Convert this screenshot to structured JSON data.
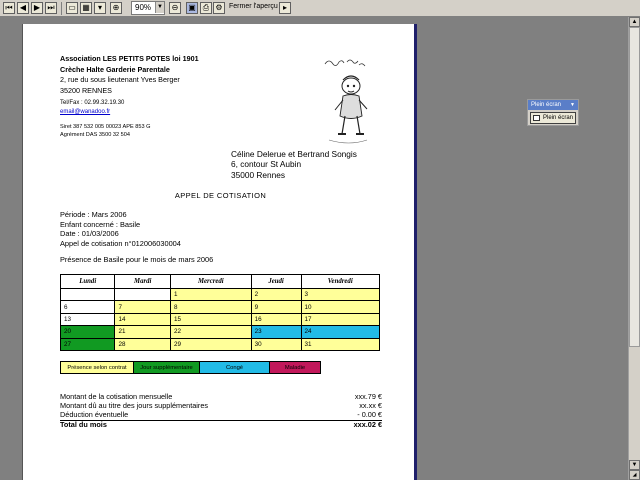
{
  "toolbar": {
    "zoom_value": "90%",
    "close_preview_label": "Fermer l'aperçu"
  },
  "icons": [
    "first-page-icon",
    "prev-page-icon",
    "next-page-icon",
    "last-page-icon",
    "one-page-icon",
    "multi-page-icon",
    "zoom-in-icon",
    "zoom-out-icon",
    "single-view-icon",
    "print-icon",
    "print-setup-icon",
    "export-icon"
  ],
  "org": {
    "line1": "Association LES PETITS POTES loi 1901",
    "line2": "Crèche Halte Garderie Parentale",
    "line3": "2, rue du sous lieutenant Yves Berger",
    "line4": "35200 RENNES"
  },
  "contact": {
    "telfax": "Tel/Fax : 02.99.32.19.30",
    "email": "email@wanadoo.fr"
  },
  "siret": {
    "line1": "Siret 387 532 005 00023 APE 853 G",
    "line2": "Agrément DAS 3500 32 504"
  },
  "recipient": {
    "name": "Céline Delerue et Bertrand Songis",
    "street": "6, contour St Aubin",
    "city": "35000 Rennes"
  },
  "title": "APPEL DE COTISATION",
  "info": {
    "period": "Période : Mars 2006",
    "child": "Enfant concerné : Basile",
    "date": "Date : 01/03/2006",
    "call": "Appel de cotisation n°012006030004"
  },
  "presence_text": "Présence de Basile pour le mois de mars 2006",
  "calendar": {
    "headers": [
      "Lundi",
      "Mardi",
      "Mercredi",
      "Jeudi",
      "Vendredi"
    ],
    "rows": [
      [
        {
          "t": "",
          "c": "#ffffff"
        },
        {
          "t": "",
          "c": "#ffffff"
        },
        {
          "t": "1",
          "c": "#ffff99"
        },
        {
          "t": "2",
          "c": "#ffff99"
        },
        {
          "t": "3",
          "c": "#ffff99"
        }
      ],
      [
        {
          "t": "6",
          "c": "#ffffff"
        },
        {
          "t": "7",
          "c": "#ffff99"
        },
        {
          "t": "8",
          "c": "#ffff99"
        },
        {
          "t": "9",
          "c": "#ffff99"
        },
        {
          "t": "10",
          "c": "#ffff99"
        }
      ],
      [
        {
          "t": "13",
          "c": "#ffffff"
        },
        {
          "t": "14",
          "c": "#ffff99"
        },
        {
          "t": "15",
          "c": "#ffff99"
        },
        {
          "t": "16",
          "c": "#ffff99"
        },
        {
          "t": "17",
          "c": "#ffff99"
        }
      ],
      [
        {
          "t": "20",
          "c": "#119a22"
        },
        {
          "t": "21",
          "c": "#ffff99"
        },
        {
          "t": "22",
          "c": "#ffff99"
        },
        {
          "t": "23",
          "c": "#22bbe6"
        },
        {
          "t": "24",
          "c": "#22bbe6"
        }
      ],
      [
        {
          "t": "27",
          "c": "#119a22"
        },
        {
          "t": "28",
          "c": "#ffff99"
        },
        {
          "t": "29",
          "c": "#ffff99"
        },
        {
          "t": "30",
          "c": "#ffff99"
        },
        {
          "t": "31",
          "c": "#ffff99"
        }
      ]
    ]
  },
  "legend": [
    {
      "label": "Présence selon contrat",
      "color": "#ffff99",
      "text_color": "#000000"
    },
    {
      "label": "Jour supplémentaire",
      "color": "#119a22",
      "text_color": "#000000"
    },
    {
      "label": "Congé",
      "color": "#22bbe6",
      "text_color": "#000000"
    },
    {
      "label": "Maladie",
      "color": "#c2185b",
      "text_color": "#000000"
    }
  ],
  "totals": [
    {
      "label": "Montant de la cotisation mensuelle",
      "value": "xxx.79 €"
    },
    {
      "label": "Montant dû au titre des jours supplémentaires",
      "value": "xx.xx €"
    },
    {
      "label": "Déduction éventuelle",
      "value": "- 0.00 €"
    }
  ],
  "total_row": {
    "label": "Total du mois",
    "value": "xxx.02 €"
  },
  "panel": {
    "title": "Plein écran",
    "button": "Plein écran"
  }
}
